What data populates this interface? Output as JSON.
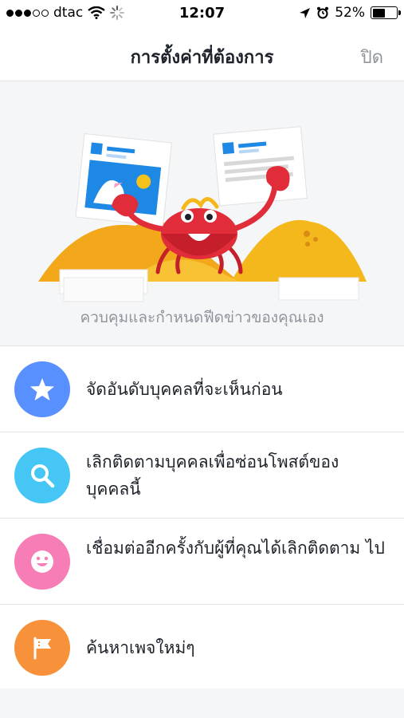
{
  "status_bar": {
    "carrier": "dtac",
    "time": "12:07",
    "battery_percent": "52%",
    "battery_level": 0.52
  },
  "nav": {
    "title": "การตั้งค่าที่ต้องการ",
    "close_label": "ปิด"
  },
  "hero": {
    "caption": "ควบคุมและกำหนดฟีดข่าวของคุณเอง"
  },
  "options": [
    {
      "label": "จัดอันดับบุคคลที่จะเห็นก่อน",
      "icon": "star-icon",
      "color": "#5890ff"
    },
    {
      "label": "เลิกติดตามบุคคลเพื่อซ่อนโพสต์ของ บุคคลนี้",
      "icon": "search-icon",
      "color": "#45c6f5"
    },
    {
      "label": "เชื่อมต่ออีกครั้งกับผู้ที่คุณได้เลิกติดตาม ไป",
      "icon": "smile-icon",
      "color": "#f67db5"
    },
    {
      "label": "ค้นหาเพจใหม่ๆ",
      "icon": "flag-icon",
      "color": "#f7923a"
    }
  ],
  "colors": {
    "hill": "#f5b81c",
    "crab": "#e12d3a",
    "accent_blue": "#1e88e5"
  }
}
